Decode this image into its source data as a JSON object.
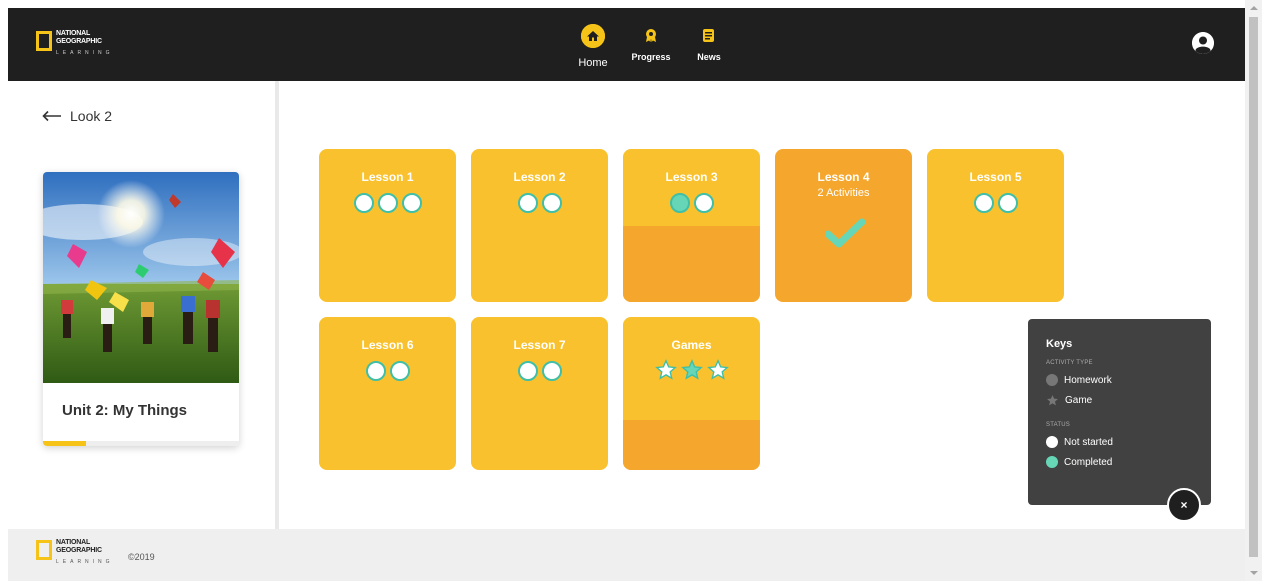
{
  "header": {
    "logo": {
      "line1": "NATIONAL",
      "line2": "GEOGRAPHIC",
      "line3": "LEARNING"
    },
    "nav": [
      {
        "label": "Home",
        "icon": "home-icon"
      },
      {
        "label": "Progress",
        "icon": "award-icon"
      },
      {
        "label": "News",
        "icon": "news-icon"
      }
    ],
    "avatar_icon": "user-avatar-icon"
  },
  "sidebar": {
    "back_label": "Look 2",
    "unit": {
      "title": "Unit 2: My Things",
      "progress_fraction": 0.22
    }
  },
  "lessons": [
    {
      "title": "Lesson 1",
      "dots": [
        "not-started",
        "not-started",
        "not-started"
      ]
    },
    {
      "title": "Lesson 2",
      "dots": [
        "not-started",
        "not-started"
      ]
    },
    {
      "title": "Lesson 3",
      "dots": [
        "completed",
        "not-started"
      ],
      "progress_fraction": 0.5
    },
    {
      "title": "Lesson 4",
      "subtitle": "2 Activities",
      "status": "completed"
    },
    {
      "title": "Lesson 5",
      "dots": [
        "not-started",
        "not-started"
      ]
    },
    {
      "title": "Lesson 6",
      "dots": [
        "not-started",
        "not-started"
      ]
    },
    {
      "title": "Lesson 7",
      "dots": [
        "not-started",
        "not-started"
      ]
    },
    {
      "title": "Games",
      "stars": [
        "not-started",
        "completed",
        "not-started"
      ],
      "progress_fraction": 0.33
    }
  ],
  "keys": {
    "title": "Keys",
    "activity_type_label": "ACTIVITY TYPE",
    "homework_label": "Homework",
    "game_label": "Game",
    "status_label": "STATUS",
    "not_started_label": "Not started",
    "completed_label": "Completed",
    "close_label": "×"
  },
  "footer": {
    "logo": {
      "line1": "NATIONAL",
      "line2": "GEOGRAPHIC",
      "line3": "LEARNING"
    },
    "copyright": "©2019"
  },
  "colors": {
    "header_bg": "#1f1f1f",
    "accent_yellow": "#f6c418",
    "lesson_yellow": "#f8c12d",
    "lesson_orange": "#f5a72d",
    "completed_teal": "#66d6b6"
  }
}
